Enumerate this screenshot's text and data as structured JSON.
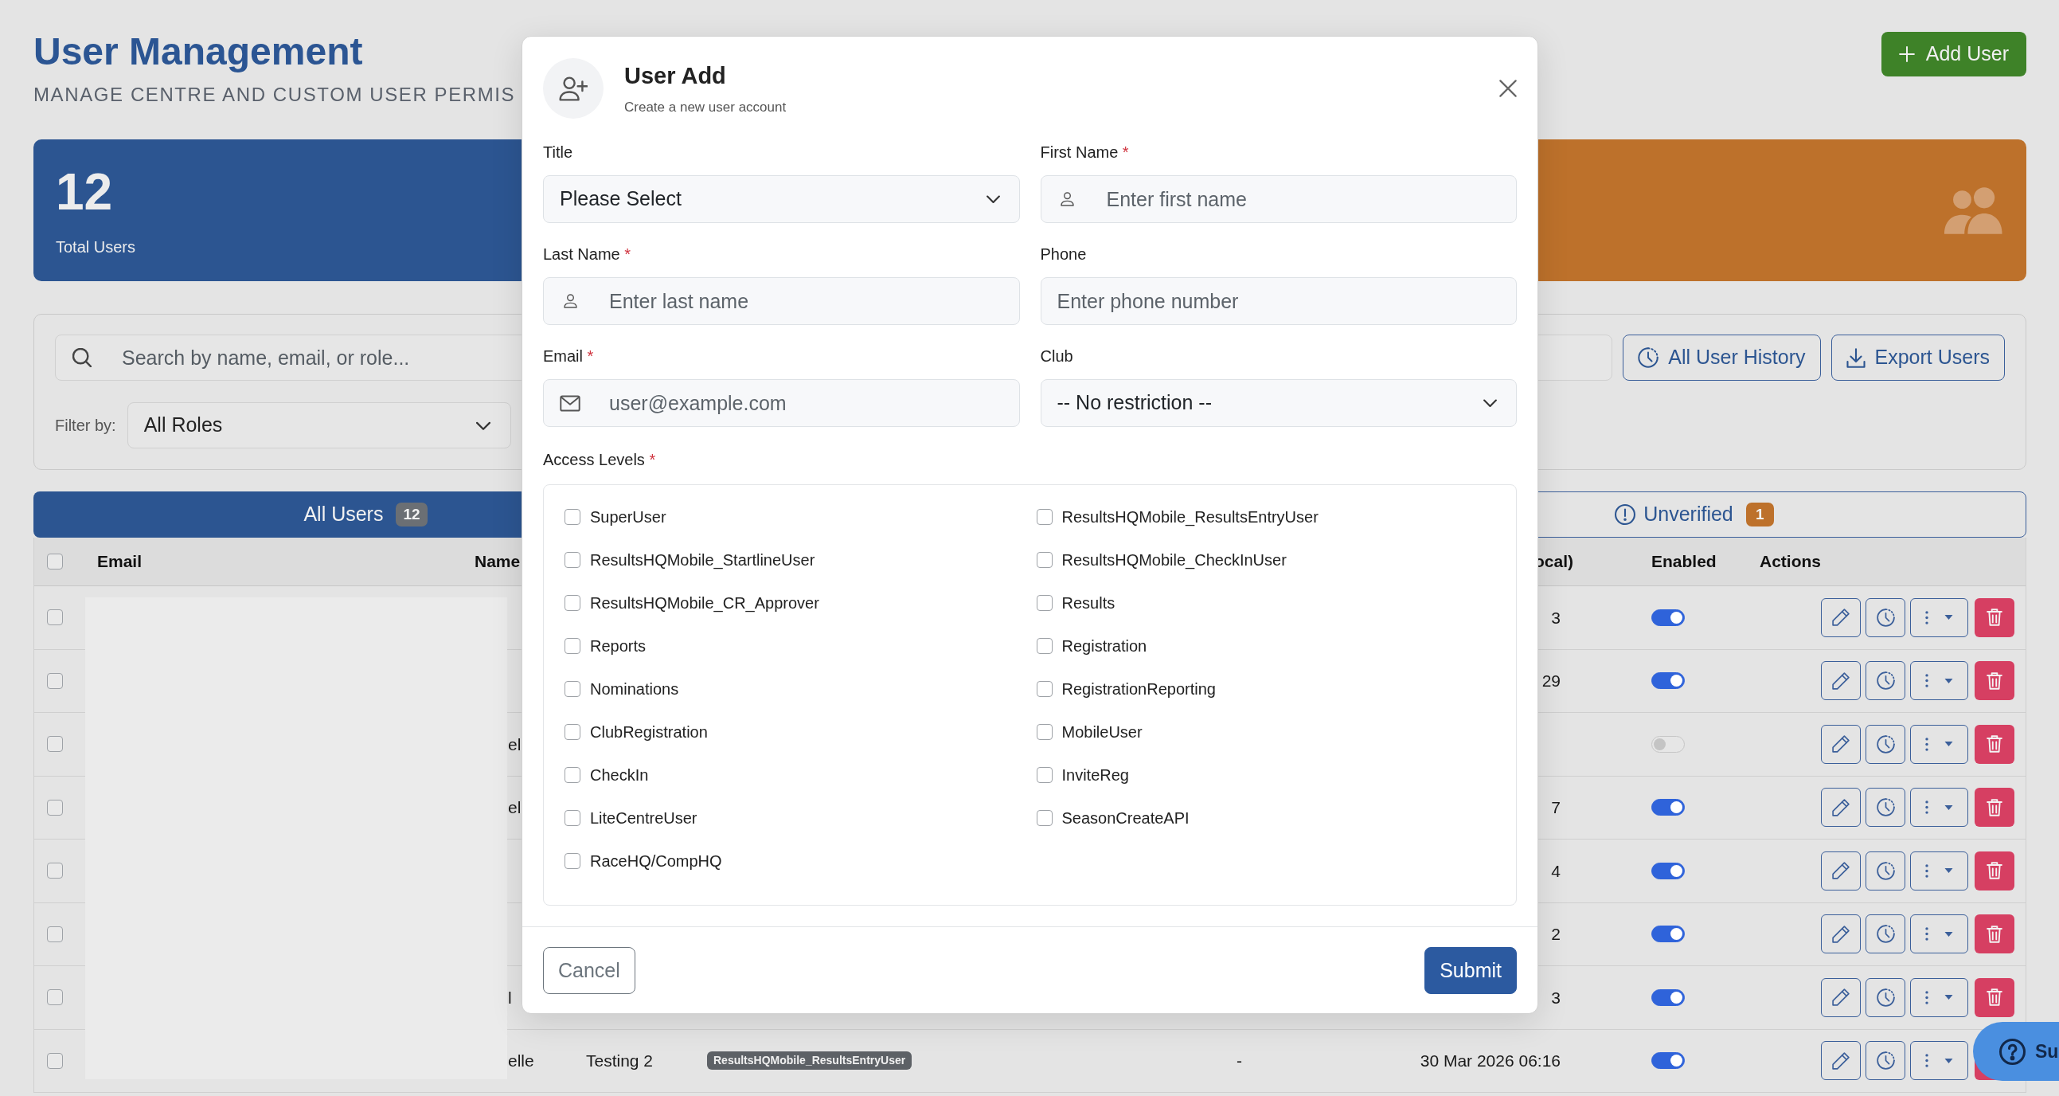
{
  "header": {
    "title": "User Management",
    "subtitle": "MANAGE CENTRE AND CUSTOM USER PERMIS",
    "add_button": "Add User"
  },
  "stat_cards": [
    {
      "kind": "figure",
      "value": "12",
      "label": "Total Users",
      "color": "#2c5591"
    },
    {
      "kind": "icon",
      "color": "#bd712b"
    }
  ],
  "filters": {
    "search": {
      "placeholder": "Search by name, email, or role..."
    },
    "buttons": [
      {
        "kind": "history",
        "label": "All User History"
      },
      {
        "kind": "download",
        "label": "Export Users"
      }
    ],
    "filter_label": "Filter by:",
    "role_select": "All Roles"
  },
  "tabs": [
    {
      "kind": "plain",
      "label": "All Users",
      "count": "12",
      "color": "#6b6f74",
      "selected": true
    },
    {
      "kind": "alert",
      "label": "Unverified",
      "count": "1",
      "color": "#bd712b",
      "selected": false
    }
  ],
  "table": {
    "select_all": {
      "checked": false
    },
    "header": {
      "email": "Email",
      "name": "Name",
      "column_6": "ocal)",
      "enabled": "Enabled",
      "actions": "Actions"
    },
    "rows": [
      {
        "checked": false,
        "column_6": "3",
        "enabled": true
      },
      {
        "checked": false,
        "column_6": "29",
        "enabled": true
      },
      {
        "checked": false,
        "name": "el",
        "enabled": false
      },
      {
        "checked": false,
        "name": "el",
        "column_6": "7",
        "enabled": true
      },
      {
        "checked": false,
        "column_6": "4",
        "enabled": true
      },
      {
        "checked": false,
        "column_6": "2",
        "enabled": true
      },
      {
        "checked": false,
        "name": "l",
        "column_6": "3",
        "enabled": true
      },
      {
        "checked": false,
        "name": "elle",
        "column_3": "Testing 2",
        "column_4": [
          "ResultsHQMobile_ResultsEntryUser"
        ],
        "column_5": "-",
        "column_6": "30 Mar 2026 06:16",
        "enabled": true
      }
    ]
  },
  "dialog": {
    "title": "User Add",
    "subtitle": "Create a new user account",
    "fields": [
      {
        "kind": "select",
        "label": "Title",
        "value": "Please Select"
      },
      {
        "kind": "person",
        "label": "First Name",
        "required_mark": "*",
        "placeholder": "Enter first name"
      },
      {
        "kind": "person",
        "label": "Last Name",
        "required_mark": "*",
        "placeholder": "Enter last name"
      },
      {
        "kind": "plain",
        "label": "Phone",
        "placeholder": "Enter phone number"
      },
      {
        "kind": "mail",
        "label": "Email",
        "required_mark": "*",
        "placeholder": "user@example.com"
      },
      {
        "kind": "select",
        "label": "Club",
        "value": "-- No restriction --"
      }
    ],
    "access_levels": {
      "label": "Access Levels",
      "required_mark": "*",
      "options": [
        {
          "label": "SuperUser",
          "checked": false
        },
        {
          "label": "ResultsHQMobile_ResultsEntryUser",
          "checked": false
        },
        {
          "label": "ResultsHQMobile_StartlineUser",
          "checked": false
        },
        {
          "label": "ResultsHQMobile_CheckInUser",
          "checked": false
        },
        {
          "label": "ResultsHQMobile_CR_Approver",
          "checked": false
        },
        {
          "label": "Results",
          "checked": false
        },
        {
          "label": "Reports",
          "checked": false
        },
        {
          "label": "Registration",
          "checked": false
        },
        {
          "label": "Nominations",
          "checked": false
        },
        {
          "label": "RegistrationReporting",
          "checked": false
        },
        {
          "label": "ClubRegistration",
          "checked": false
        },
        {
          "label": "MobileUser",
          "checked": false
        },
        {
          "label": "CheckIn",
          "checked": false
        },
        {
          "label": "InviteReg",
          "checked": false
        },
        {
          "label": "LiteCentreUser",
          "checked": false
        },
        {
          "label": "SeasonCreateAPI",
          "checked": false
        },
        {
          "label": "RaceHQ/CompHQ",
          "checked": false
        }
      ]
    },
    "buttons": [
      {
        "kind": "secondary",
        "label": "Cancel"
      },
      {
        "kind": "primary",
        "label": "Submit"
      }
    ]
  },
  "help_widget": {
    "label": "Su"
  }
}
